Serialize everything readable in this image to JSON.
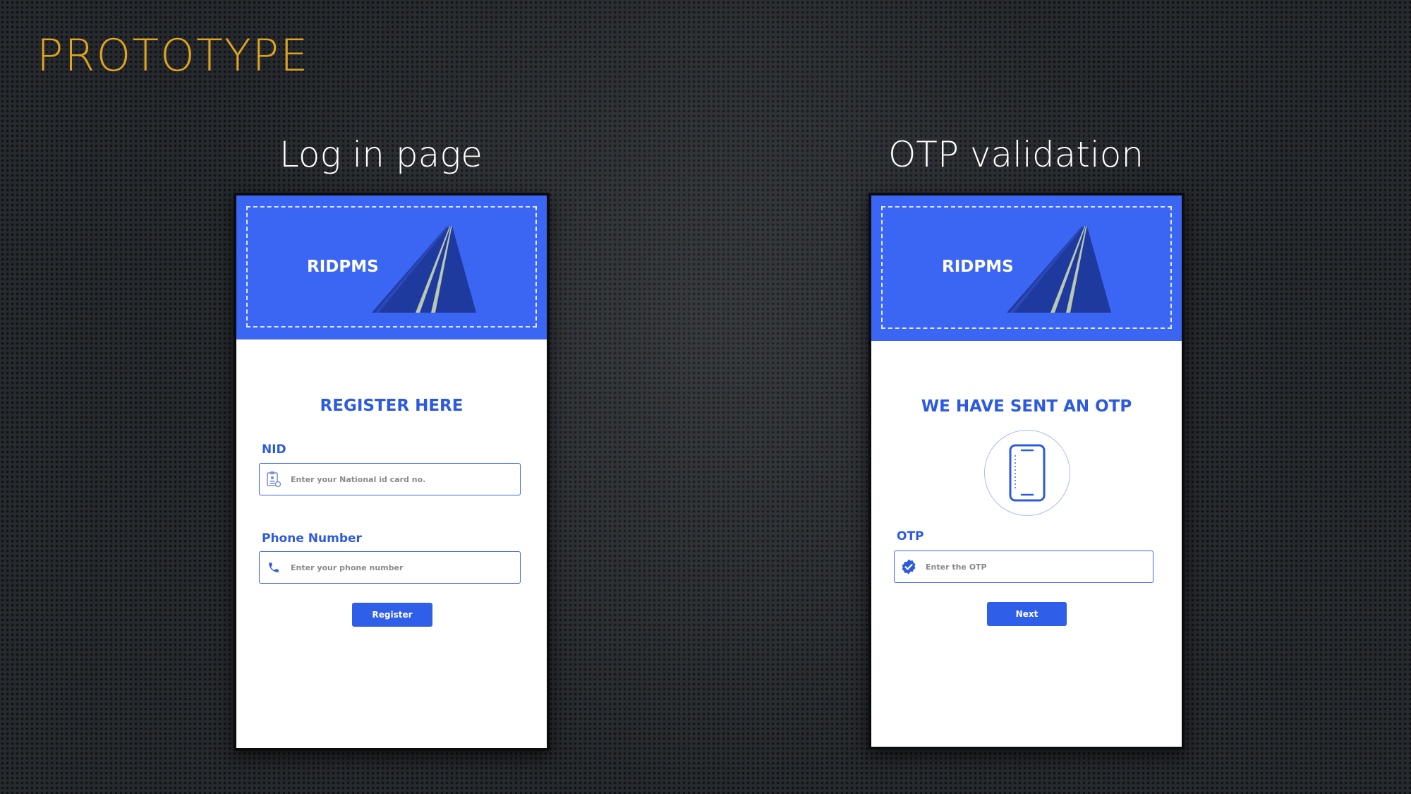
{
  "slide": {
    "title": "PROTOTYPE",
    "title_color": "#e0a41f"
  },
  "login_screen": {
    "heading": "Log in page",
    "brand": "RIDPMS",
    "form_title": "REGISTER HERE",
    "nid": {
      "label": "NID",
      "placeholder": "Enter your National id card no.",
      "icon": "id-card-icon"
    },
    "phone": {
      "label": "Phone Number",
      "placeholder": "Enter your phone number",
      "icon": "phone-icon"
    },
    "submit_label": "Register"
  },
  "otp_screen": {
    "heading": "OTP validation",
    "brand": "RIDPMS",
    "form_title": "WE HAVE SENT AN OTP",
    "illustration": "smartphone-icon",
    "otp": {
      "label": "OTP",
      "placeholder": "Enter the OTP",
      "icon": "verified-check-icon"
    },
    "submit_label": "Next"
  },
  "colors": {
    "primary_blue": "#3a66f3",
    "text_blue": "#2d5bdf",
    "road_dark": "#1f3a9e"
  }
}
